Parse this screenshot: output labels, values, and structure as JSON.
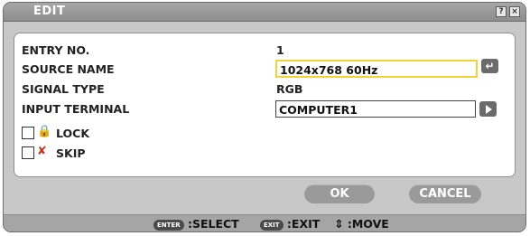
{
  "window": {
    "title": "EDIT",
    "help_label": "?",
    "close_label": "×"
  },
  "form": {
    "entry_no": {
      "label": "ENTRY NO.",
      "value": "1"
    },
    "source_name": {
      "label": "SOURCE NAME",
      "value": "1024x768 60Hz",
      "enter_icon": "↵"
    },
    "signal_type": {
      "label": "SIGNAL TYPE",
      "value": "RGB"
    },
    "input_terminal": {
      "label": "INPUT TERMINAL",
      "value": "COMPUTER1"
    },
    "lock": {
      "label": "LOCK",
      "checked": false,
      "icon": "padlock-icon",
      "icon_glyph": "🔒"
    },
    "skip": {
      "label": "SKIP",
      "checked": false,
      "icon": "skip-icon",
      "icon_glyph": "✘"
    }
  },
  "buttons": {
    "ok": "OK",
    "cancel": "CANCEL"
  },
  "statusbar": {
    "select_key": "ENTER",
    "select_label": ":SELECT",
    "exit_key": "EXIT",
    "exit_label": ":EXIT",
    "move_glyph": "⇕",
    "move_label": ":MOVE"
  },
  "colors": {
    "focus_border": "#f1d23a",
    "button_gray": "#9a9a9a",
    "title_bar": "#9a9a9a"
  }
}
